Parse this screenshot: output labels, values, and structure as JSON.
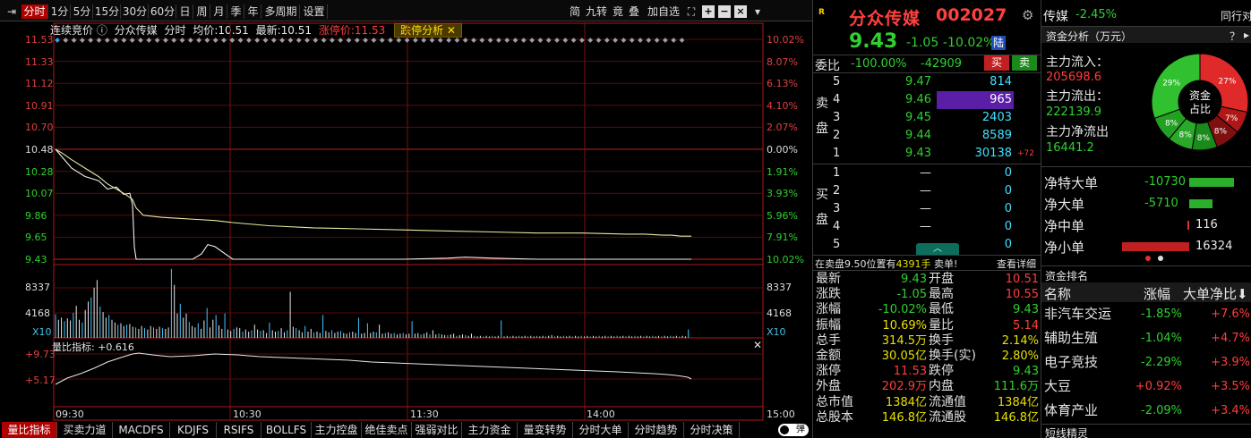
{
  "toolbar": {
    "items": [
      "分时",
      "1分",
      "5分",
      "15分",
      "30分",
      "60分",
      "日",
      "周",
      "月",
      "季",
      "年",
      "多周期",
      "设置"
    ],
    "right_items": [
      "简",
      "九转",
      "竟",
      "叠",
      "加自选"
    ],
    "active": "分时"
  },
  "chart_header": {
    "mode": "连续竞价",
    "stock": "分众传媒",
    "period": "分时",
    "avg_label": "均价:",
    "avg_value": "10.51",
    "last_label": "最新:",
    "last_value": "10.51",
    "limit_up_label": "涨停价:",
    "limit_up_value": "11.53",
    "tab": "跌停分析"
  },
  "price_axis": {
    "left": [
      "11.53",
      "11.33",
      "11.12",
      "10.91",
      "10.70",
      "10.48",
      "10.28",
      "10.07",
      "9.86",
      "9.65",
      "9.43"
    ],
    "right": [
      "10.02%",
      "8.07%",
      "6.13%",
      "4.10%",
      "2.07%",
      "0.00%",
      "1.91%",
      "3.93%",
      "5.96%",
      "7.91%",
      "10.02%"
    ]
  },
  "volume_axis": {
    "left": [
      "8337",
      "4168",
      "X10"
    ],
    "right": [
      "8337",
      "4168",
      "X10"
    ]
  },
  "volume_ratio": {
    "title": "量比指标:",
    "value": "+0.616",
    "left": [
      "+9.73",
      "+5.17"
    ]
  },
  "time_axis": [
    "09:30",
    "10:30",
    "11:30",
    "14:00",
    "15:00"
  ],
  "bottom_tabs": [
    "量比指标",
    "买卖力道",
    "MACDFS",
    "KDJFS",
    "RSIFS",
    "BOLLFS",
    "主力控盘",
    "绝佳卖点",
    "强弱对比",
    "主力资金",
    "量变转势",
    "分时大单",
    "分时趋势",
    "分时决策"
  ],
  "bottom_extra": "弹",
  "quote": {
    "badge": "R",
    "name": "分众传媒",
    "code": "002027",
    "price": "9.43",
    "change": "-1.05",
    "pct": "-10.02%",
    "tag": "陆"
  },
  "orderbook": {
    "ratio_label": "委比",
    "ratio_value": "-100.00%",
    "diff_value": "-42909",
    "buy_btn": "买",
    "sell_btn": "卖",
    "sell_label": "卖盘",
    "buy_label": "买盘",
    "asks": [
      {
        "lvl": "5",
        "price": "9.47",
        "vol": "814",
        "chg": ""
      },
      {
        "lvl": "4",
        "price": "9.46",
        "vol": "965",
        "chg": ""
      },
      {
        "lvl": "3",
        "price": "9.45",
        "vol": "2403",
        "chg": ""
      },
      {
        "lvl": "2",
        "price": "9.44",
        "vol": "8589",
        "chg": ""
      },
      {
        "lvl": "1",
        "price": "9.43",
        "vol": "30138",
        "chg": "+72"
      }
    ],
    "bids": [
      {
        "lvl": "1",
        "price": "—",
        "vol": "0"
      },
      {
        "lvl": "2",
        "price": "—",
        "vol": "0"
      },
      {
        "lvl": "3",
        "price": "—",
        "vol": "0"
      },
      {
        "lvl": "4",
        "price": "—",
        "vol": "0"
      },
      {
        "lvl": "5",
        "price": "—",
        "vol": "0"
      }
    ],
    "notice_prefix": "在卖盘9.50位置有",
    "notice_qty": "4391手",
    "notice_suffix": "卖单!",
    "notice_link": "查看详细"
  },
  "stats": [
    {
      "k1": "最新",
      "v1": "9.43",
      "c1": "grn",
      "k2": "开盘",
      "v2": "10.51",
      "c2": "red"
    },
    {
      "k1": "涨跌",
      "v1": "-1.05",
      "c1": "grn",
      "k2": "最高",
      "v2": "10.55",
      "c2": "red"
    },
    {
      "k1": "涨幅",
      "v1": "-10.02%",
      "c1": "grn",
      "k2": "最低",
      "v2": "9.43",
      "c2": "grn"
    },
    {
      "k1": "振幅",
      "v1": "10.69%",
      "c1": "yel",
      "k2": "量比",
      "v2": "5.14",
      "c2": "red"
    },
    {
      "k1": "总手",
      "v1": "314.5万",
      "c1": "yel",
      "k2": "换手",
      "v2": "2.14%",
      "c2": "yel"
    },
    {
      "k1": "金额",
      "v1": "30.05亿",
      "c1": "yel",
      "k2": "换手(实)",
      "v2": "2.80%",
      "c2": "yel"
    },
    {
      "k1": "涨停",
      "v1": "11.53",
      "c1": "red",
      "k2": "跌停",
      "v2": "9.43",
      "c2": "grn"
    },
    {
      "k1": "外盘",
      "v1": "202.9万",
      "c1": "red",
      "k2": "内盘",
      "v2": "111.6万",
      "c2": "grn"
    },
    {
      "k1": "总市值",
      "v1": "1384亿",
      "c1": "yel",
      "k2": "流通值",
      "v2": "1384亿",
      "c2": "yel"
    },
    {
      "k1": "总股本",
      "v1": "146.8亿",
      "c1": "yel",
      "k2": "流通股",
      "v2": "146.8亿",
      "c2": "yel"
    }
  ],
  "sector": {
    "name": "传媒",
    "pct": "-2.45%",
    "more": "同行对"
  },
  "fund": {
    "title": "资金分析（万元）",
    "help": "？",
    "inflow_label": "主力流入：",
    "inflow_value": "205698.6",
    "outflow_label": "主力流出：",
    "outflow_value": "222139.9",
    "net_label": "主力净流出",
    "net_value": "16441.2",
    "donut_center": "资金占比",
    "slices": [
      {
        "label": "27%",
        "value": 27,
        "color": "#e02a2a"
      },
      {
        "label": "7%",
        "value": 7,
        "color": "#b01818"
      },
      {
        "label": "8%",
        "value": 8,
        "color": "#801010"
      },
      {
        "label": "8%",
        "value": 8,
        "color": "#1a8a1a"
      },
      {
        "label": "8%",
        "value": 8,
        "color": "#2aa82a"
      },
      {
        "label": "8%",
        "value": 8,
        "color": "#22a022"
      },
      {
        "label": "29%",
        "value": 29,
        "color": "#30c030"
      }
    ],
    "flows": [
      {
        "label": "净特大单",
        "value": "-10730",
        "fill": 0.62,
        "color": "#2ab02a"
      },
      {
        "label": "净大单",
        "value": "-5710",
        "fill": 0.33,
        "color": "#2ab02a"
      },
      {
        "label": "净中单",
        "value": "116",
        "fill": 0.01,
        "color": "#e03030"
      },
      {
        "label": "净小单",
        "value": "16324",
        "fill": 0.94,
        "color": "#c02020"
      }
    ]
  },
  "rank": {
    "title": "资金排名",
    "headers": [
      "名称",
      "涨幅",
      "大单净比"
    ],
    "rows": [
      {
        "name": "非汽车交运",
        "pct": "-1.85%",
        "pc": "grn",
        "ratio": "+7.6%"
      },
      {
        "name": "辅助生殖",
        "pct": "-1.04%",
        "pc": "grn",
        "ratio": "+4.7%"
      },
      {
        "name": "电子竞技",
        "pct": "-2.29%",
        "pc": "grn",
        "ratio": "+3.9%"
      },
      {
        "name": "大豆",
        "pct": "+0.92%",
        "pc": "red",
        "ratio": "+3.5%"
      },
      {
        "name": "体育产业",
        "pct": "-2.09%",
        "pc": "grn",
        "ratio": "+3.4%"
      }
    ],
    "footer": "短线精灵"
  },
  "chart_data": [
    {
      "type": "line",
      "title": "",
      "x_labels": [
        "09:30",
        "10:30",
        "11:30",
        "14:00",
        "15:00"
      ],
      "ylim": [
        9.43,
        11.53
      ],
      "series": [
        {
          "values": [
            10.48,
            10.4,
            10.3,
            10.22,
            10.18,
            10.1,
            10.12,
            10.05,
            10.06,
            9.95,
            9.55,
            9.43,
            9.43,
            9.43,
            9.43,
            9.43,
            9.43,
            9.48,
            9.57,
            9.55,
            9.43,
            9.43,
            9.43,
            9.43,
            9.43,
            9.43,
            9.44,
            9.45,
            9.44,
            9.43,
            9.43
          ]
        },
        {
          "values": [
            10.48,
            10.44,
            10.38,
            10.3,
            10.22,
            10.15,
            10.1,
            10.05,
            10.0,
            9.92,
            9.85,
            9.83,
            9.82,
            9.81,
            9.8,
            9.78,
            9.75,
            9.73,
            9.72,
            9.71,
            9.7,
            9.69,
            9.68,
            9.68,
            9.67,
            9.67,
            9.66,
            9.66,
            9.65,
            9.65,
            9.65
          ]
        }
      ]
    },
    {
      "type": "bar",
      "title": "",
      "ylim": [
        0,
        10000
      ],
      "values": [
        3400,
        2600,
        2900,
        2400,
        2800,
        2500,
        3600,
        4600,
        2600,
        2200,
        4000,
        5200,
        5800,
        7200,
        8300,
        4500,
        3700,
        2900,
        3300,
        2600,
        2200,
        1900,
        2100,
        1700,
        1900,
        2000,
        1600,
        1500,
        1300,
        1700,
        1400,
        1200,
        1700,
        1500,
        1300,
        1600,
        1400,
        1300,
        1500,
        9900,
        7600,
        3500,
        4900,
        2900,
        3500,
        2300,
        1700,
        1500,
        2100,
        1300,
        2500,
        4300,
        1500,
        2600,
        3300,
        1800,
        1300,
        3500,
        1200,
        1000,
        1300,
        1500,
        1400,
        900,
        1200,
        900,
        1100,
        1900,
        1200,
        1000,
        1100,
        700,
        2200,
        1100,
        900,
        1000,
        1400,
        800,
        1100,
        6600,
        1600,
        1400,
        1100,
        800,
        1700,
        900,
        1300,
        800,
        900,
        700,
        3300,
        1000,
        800,
        1100,
        700,
        900,
        1000,
        700,
        600,
        800,
        900,
        700,
        2900,
        600,
        700,
        2100,
        700,
        900,
        800,
        1900,
        600,
        700,
        800,
        600,
        700,
        500,
        600,
        700,
        500,
        600,
        2400,
        600,
        700,
        500,
        600,
        800,
        500,
        1100,
        500,
        600,
        500,
        400,
        400,
        500,
        600,
        300,
        400,
        500,
        400,
        300,
        600,
        300,
        200,
        300,
        200,
        300,
        200,
        300,
        200,
        300,
        2500,
        200,
        300,
        200,
        300,
        200,
        300,
        200,
        300,
        200,
        300,
        200,
        300,
        200,
        300,
        200,
        300,
        400,
        200,
        300,
        200,
        300,
        200,
        300,
        200,
        300,
        200,
        300,
        200,
        300,
        200,
        300,
        200,
        300,
        200,
        300,
        200,
        300,
        200,
        300,
        200,
        300,
        200,
        300,
        200,
        300,
        200,
        300,
        200,
        300,
        200,
        300,
        200,
        300,
        200,
        300,
        200,
        300,
        200,
        300,
        200,
        300,
        200,
        1200
      ]
    }
  ]
}
